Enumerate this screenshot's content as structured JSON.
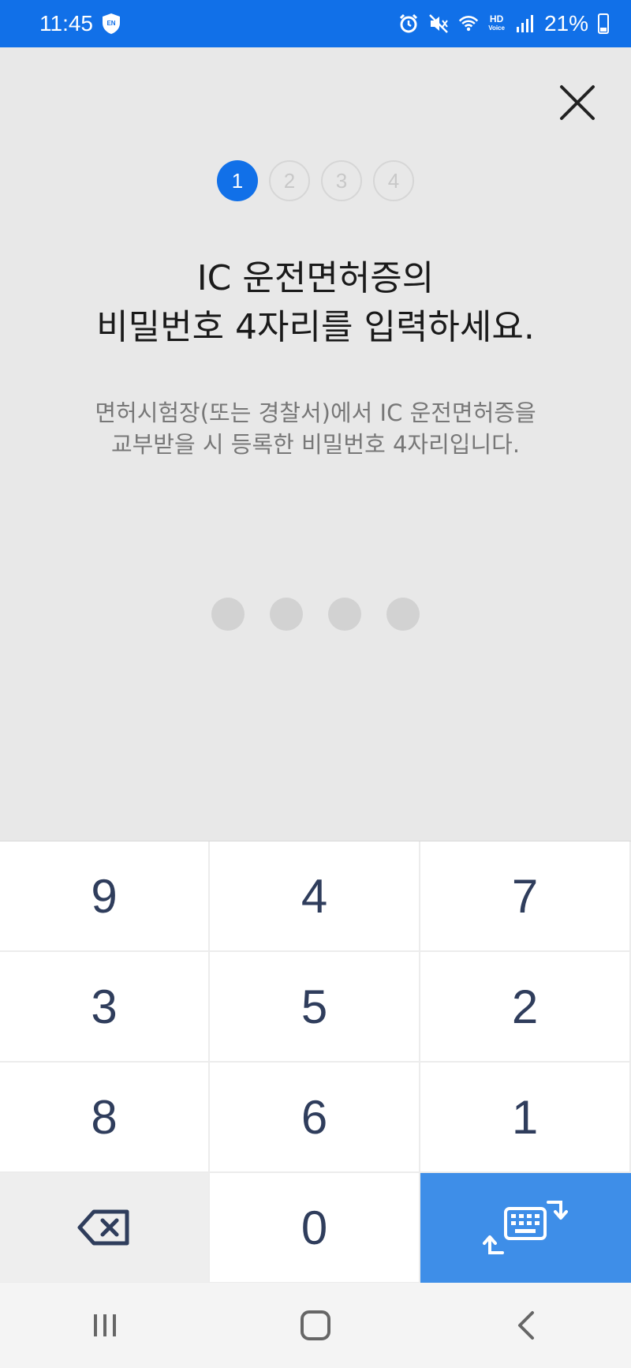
{
  "status_bar": {
    "time": "11:45",
    "vpn_label": "EN",
    "hd_top": "HD",
    "hd_bottom": "Voice",
    "battery_text": "21%"
  },
  "steps": [
    {
      "label": "1",
      "active": true
    },
    {
      "label": "2",
      "active": false
    },
    {
      "label": "3",
      "active": false
    },
    {
      "label": "4",
      "active": false
    }
  ],
  "title": {
    "line1": "IC 운전면허증의",
    "line2": "비밀번호 4자리를 입력하세요."
  },
  "description": {
    "line1": "면허시험장(또는 경찰서)에서 IC 운전면허증을",
    "line2": "교부받을 시 등록한 비밀번호 4자리입니다."
  },
  "pin": {
    "length": 4,
    "entered": 0
  },
  "keypad": {
    "keys": [
      "9",
      "4",
      "7",
      "3",
      "5",
      "2",
      "8",
      "6",
      "1"
    ],
    "zero": "0",
    "backspace_icon": "backspace-icon",
    "switch_icon": "keyboard-switch-icon"
  },
  "colors": {
    "accent": "#1170e8",
    "keypad_blue": "#3e8ee8",
    "key_text": "#2f3d5c"
  }
}
